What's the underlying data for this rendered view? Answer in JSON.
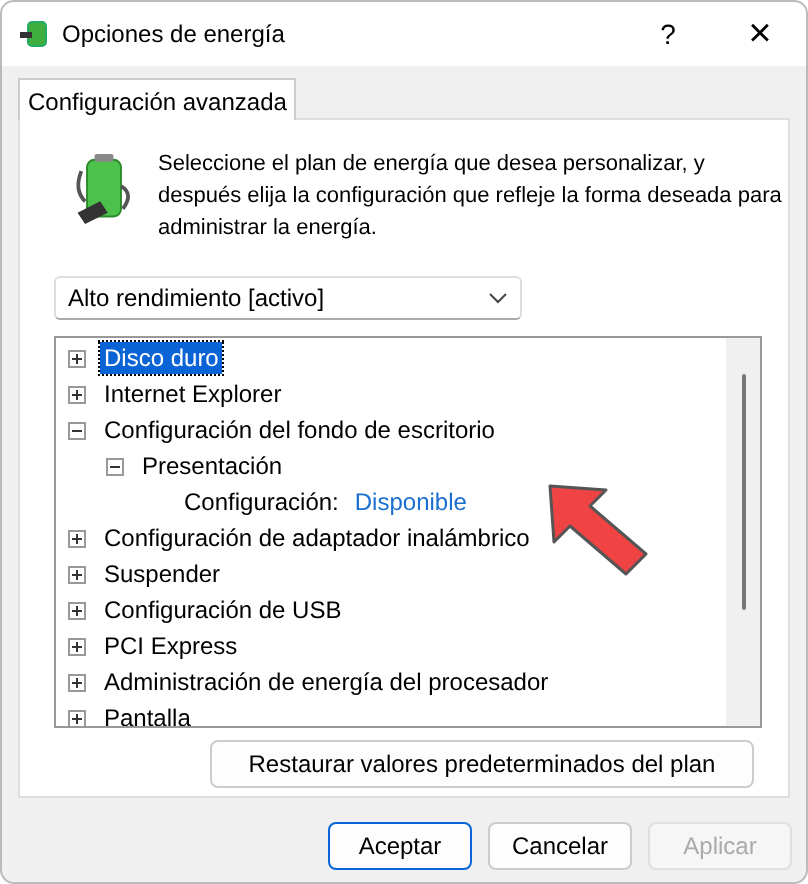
{
  "window": {
    "title": "Opciones de energía",
    "help": "?",
    "close": "×"
  },
  "tabs": [
    {
      "label": "Configuración avanzada",
      "selected": true
    }
  ],
  "description": "Seleccione el plan de energía que desea personalizar, y después elija la configuración que refleje la forma deseada para administrar la energía.",
  "plan_dropdown": {
    "value": "Alto rendimiento [activo]"
  },
  "tree": [
    {
      "label": "Disco duro",
      "expanded": false,
      "selected": true
    },
    {
      "label": "Internet Explorer",
      "expanded": false,
      "selected": false
    },
    {
      "label": "Configuración del fondo de escritorio",
      "expanded": true,
      "selected": false,
      "children": [
        {
          "label": "Presentación",
          "expanded": true,
          "selected": false,
          "children": [
            {
              "kind": "setting",
              "label": "Configuración:",
              "value": "Disponible",
              "selected": false
            }
          ]
        }
      ]
    },
    {
      "label": "Configuración de adaptador inalámbrico",
      "expanded": false,
      "selected": false
    },
    {
      "label": "Suspender",
      "expanded": false,
      "selected": false
    },
    {
      "label": "Configuración de USB",
      "expanded": false,
      "selected": false
    },
    {
      "label": "PCI Express",
      "expanded": false,
      "selected": false
    },
    {
      "label": "Administración de energía del procesador",
      "expanded": false,
      "selected": false
    },
    {
      "label": "Pantalla",
      "expanded": false,
      "selected": false
    }
  ],
  "restore_button": "Restaurar valores predeterminados del plan",
  "buttons": [
    {
      "label": "Aceptar",
      "disabled": false
    },
    {
      "label": "Cancelar",
      "disabled": false
    },
    {
      "label": "Aplicar",
      "disabled": true
    }
  ]
}
